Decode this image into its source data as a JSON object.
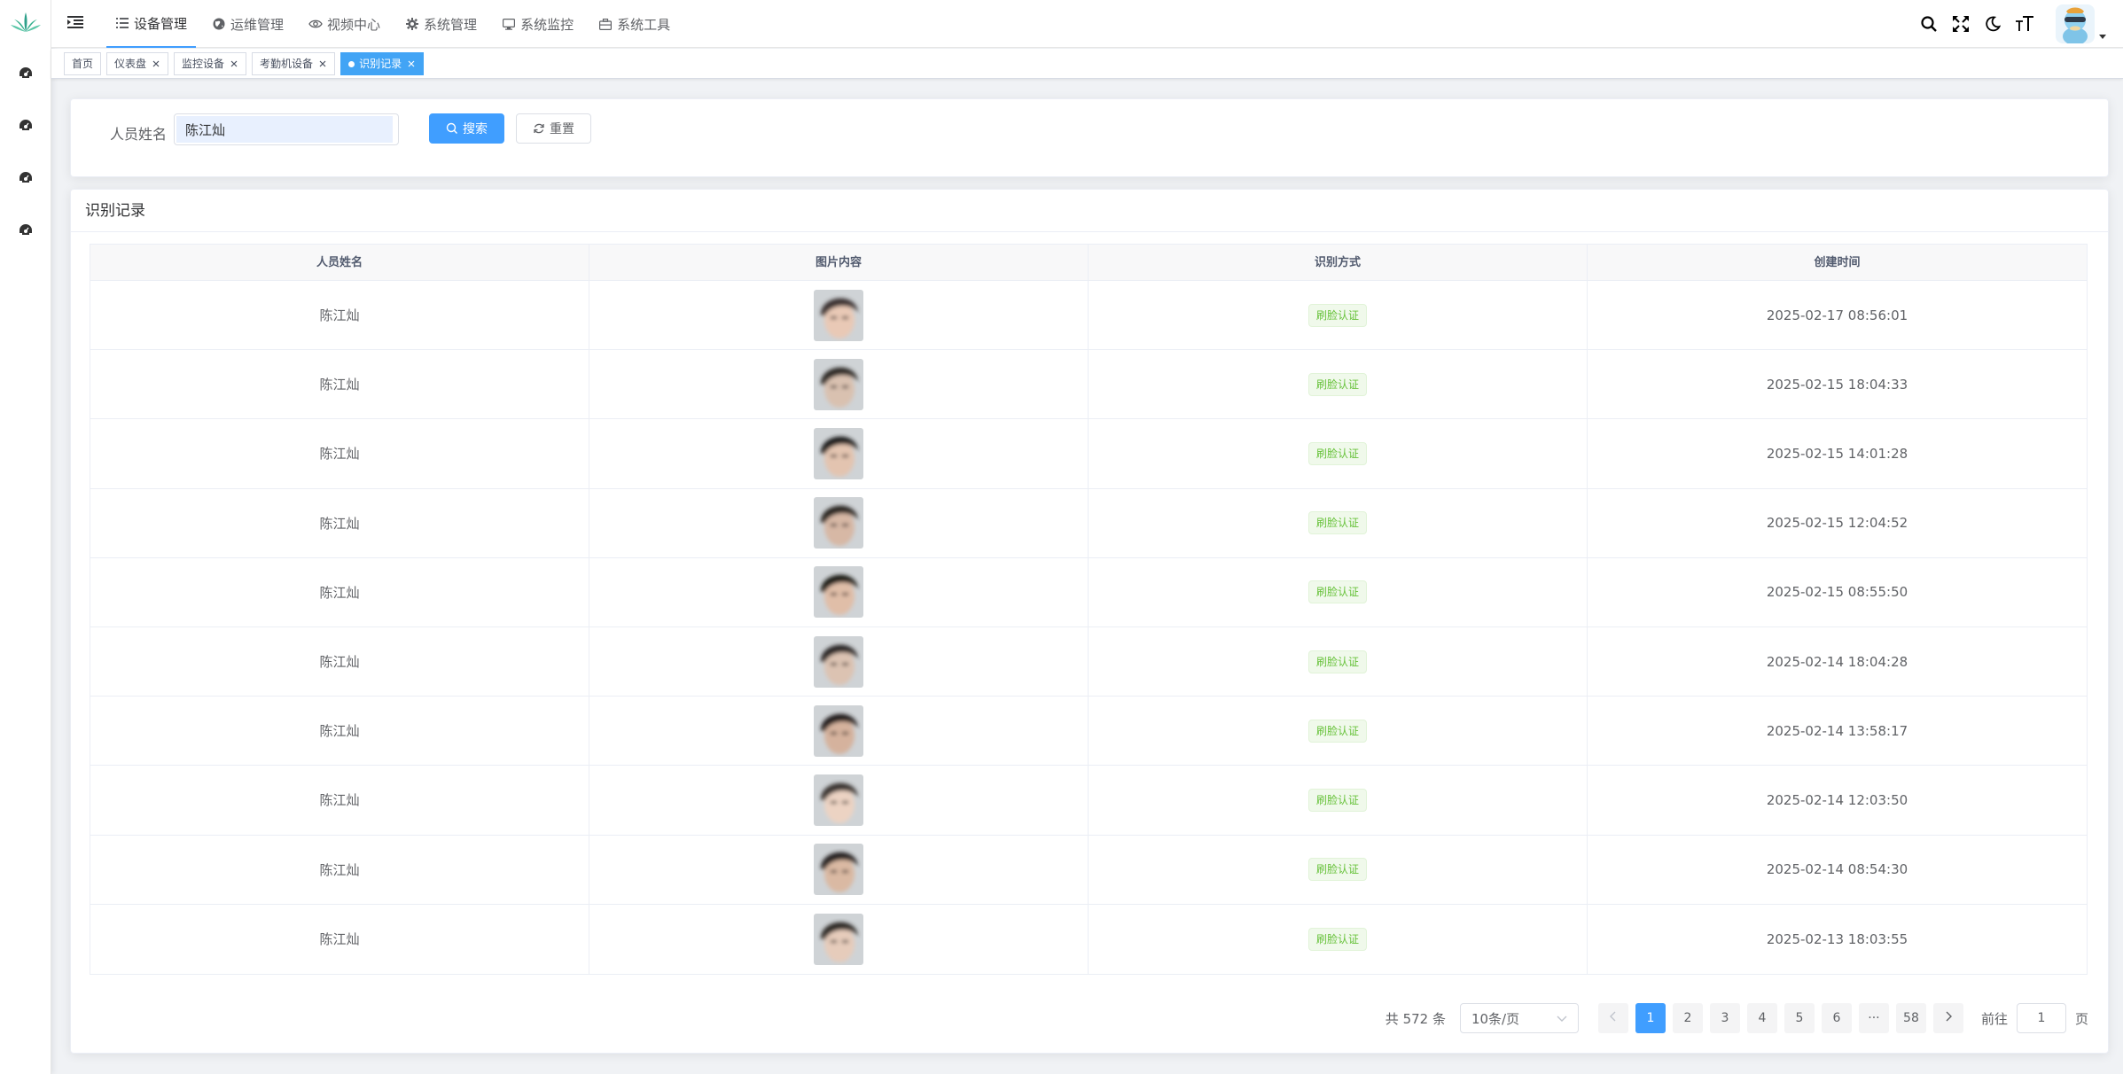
{
  "nav": {
    "menu": [
      {
        "label": "设备管理",
        "icon": "list-icon",
        "active": true
      },
      {
        "label": "运维管理",
        "icon": "globe-icon",
        "active": false
      },
      {
        "label": "视频中心",
        "icon": "eye-icon",
        "active": false
      },
      {
        "label": "系统管理",
        "icon": "gear-icon",
        "active": false
      },
      {
        "label": "系统监控",
        "icon": "monitor-icon",
        "active": false
      },
      {
        "label": "系统工具",
        "icon": "toolbox-icon",
        "active": false
      }
    ],
    "tools": [
      "search-icon",
      "fullscreen-icon",
      "moon-icon",
      "font-size-icon"
    ]
  },
  "tags": [
    {
      "label": "首页",
      "closable": false,
      "active": false
    },
    {
      "label": "仪表盘",
      "closable": true,
      "active": false
    },
    {
      "label": "监控设备",
      "closable": true,
      "active": false
    },
    {
      "label": "考勤机设备",
      "closable": true,
      "active": false
    },
    {
      "label": "识别记录",
      "closable": true,
      "active": true
    }
  ],
  "search": {
    "label": "人员姓名",
    "value": "陈江灿",
    "search_btn": "搜索",
    "reset_btn": "重置"
  },
  "card_title": "识别记录",
  "table": {
    "headers": [
      "人员姓名",
      "图片内容",
      "识别方式",
      "创建时间"
    ],
    "rows": [
      {
        "name": "陈江灿",
        "method": "刷脸认证",
        "time": "2025-02-17 08:56:01"
      },
      {
        "name": "陈江灿",
        "method": "刷脸认证",
        "time": "2025-02-15 18:04:33"
      },
      {
        "name": "陈江灿",
        "method": "刷脸认证",
        "time": "2025-02-15 14:01:28"
      },
      {
        "name": "陈江灿",
        "method": "刷脸认证",
        "time": "2025-02-15 12:04:52"
      },
      {
        "name": "陈江灿",
        "method": "刷脸认证",
        "time": "2025-02-15 08:55:50"
      },
      {
        "name": "陈江灿",
        "method": "刷脸认证",
        "time": "2025-02-14 18:04:28"
      },
      {
        "name": "陈江灿",
        "method": "刷脸认证",
        "time": "2025-02-14 13:58:17"
      },
      {
        "name": "陈江灿",
        "method": "刷脸认证",
        "time": "2025-02-14 12:03:50"
      },
      {
        "name": "陈江灿",
        "method": "刷脸认证",
        "time": "2025-02-14 08:54:30"
      },
      {
        "name": "陈江灿",
        "method": "刷脸认证",
        "time": "2025-02-13 18:03:55"
      }
    ]
  },
  "pagination": {
    "total_text": "共 572 条",
    "page_size": "10条/页",
    "pages": [
      "1",
      "2",
      "3",
      "4",
      "5",
      "6",
      "···",
      "58"
    ],
    "current": "1",
    "goto_label": "前往",
    "goto_value": "1",
    "page_unit": "页"
  },
  "colors": {
    "primary": "#409eff",
    "success": "#67c23a"
  }
}
